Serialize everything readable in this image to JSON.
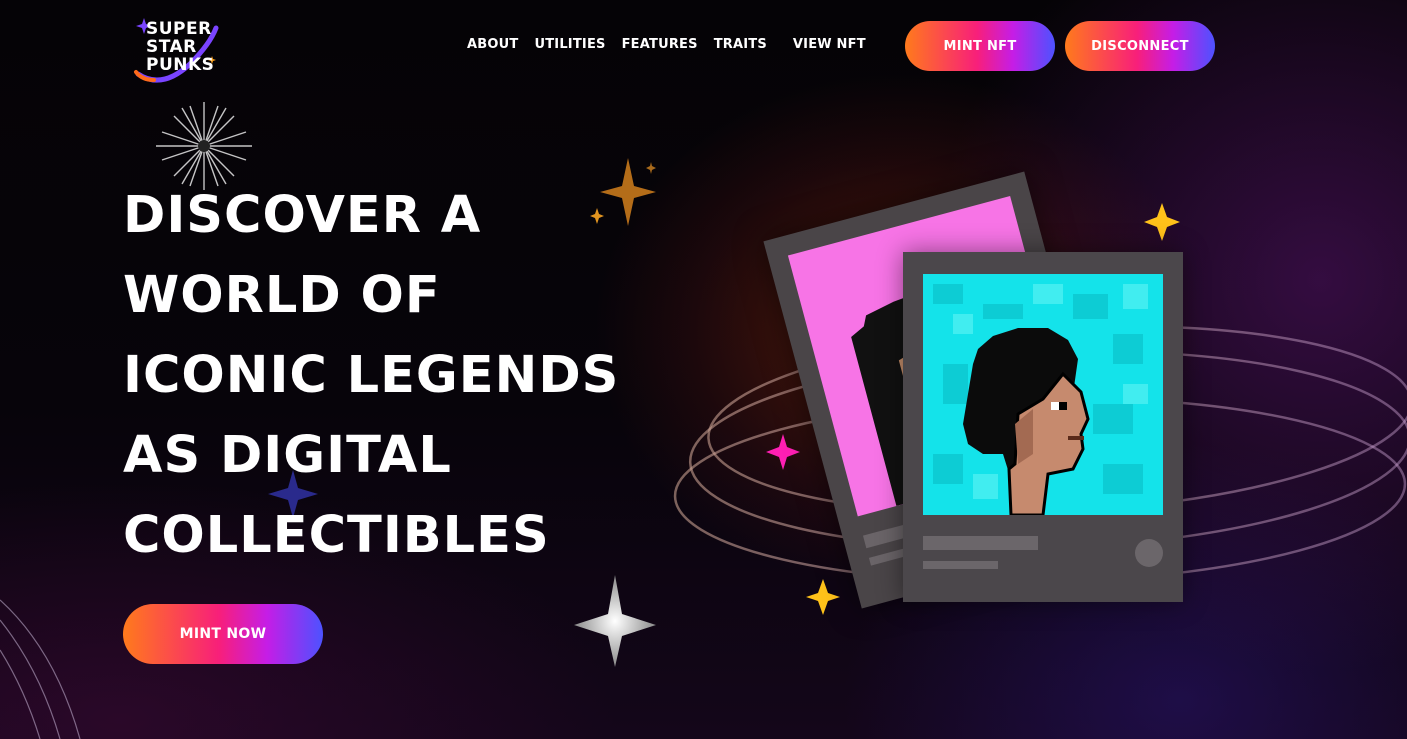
{
  "brand": {
    "logo_lines": [
      "SUPER",
      "STAR",
      "PUNKS"
    ]
  },
  "nav": {
    "items": [
      {
        "label": "ABOUT"
      },
      {
        "label": "UTILITIES"
      },
      {
        "label": "FEATURES"
      },
      {
        "label": "TRAITS"
      },
      {
        "label": "VIEW NFT"
      }
    ]
  },
  "header_actions": {
    "mint_label": "MINT NFT",
    "disconnect_label": "DISCONNECT"
  },
  "hero": {
    "headline_lines": [
      "DISCOVER A",
      "WORLD OF",
      "ICONIC LEGENDS",
      "AS DIGITAL",
      "COLLECTIBLES"
    ],
    "cta_label": "MINT NOW"
  },
  "nft_preview": {
    "back_card_background": "#f774e6",
    "front_card_background": "#14e3ea"
  },
  "colors": {
    "button_gradient": [
      "#ff7a1c",
      "#f81f7a",
      "#c51de6",
      "#4d52ff"
    ],
    "star_gold": "#ffc21a",
    "star_magenta": "#ff1fb4",
    "star_orange": "#d98a1c",
    "star_navy": "#2a2a8c"
  },
  "icons": [
    "sparkle-star-icon",
    "starburst-icon"
  ]
}
